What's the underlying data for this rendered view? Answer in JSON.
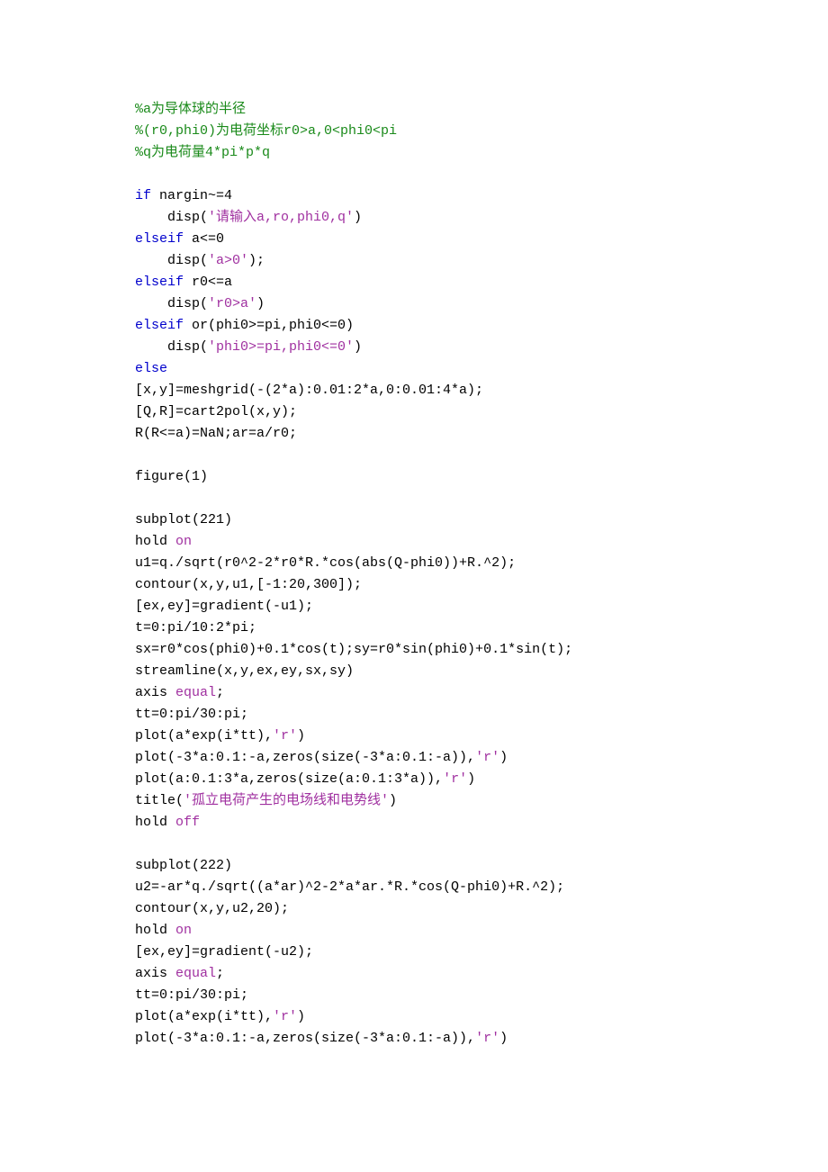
{
  "code": {
    "lines": [
      [
        {
          "cls": "comment",
          "t": "%a为导体球的半径"
        }
      ],
      [
        {
          "cls": "comment",
          "t": "%(r0,phi0)为电荷坐标r0>a,0<phi0<pi"
        }
      ],
      [
        {
          "cls": "comment",
          "t": "%q为电荷量4*pi*p*q"
        }
      ],
      [
        {
          "cls": "plain",
          "t": ""
        }
      ],
      [
        {
          "cls": "keyword",
          "t": "if"
        },
        {
          "cls": "plain",
          "t": " nargin~=4"
        }
      ],
      [
        {
          "cls": "plain",
          "t": "    disp("
        },
        {
          "cls": "string",
          "t": "'请输入a,ro,phi0,q'"
        },
        {
          "cls": "plain",
          "t": ")"
        }
      ],
      [
        {
          "cls": "keyword",
          "t": "elseif"
        },
        {
          "cls": "plain",
          "t": " a<=0"
        }
      ],
      [
        {
          "cls": "plain",
          "t": "    disp("
        },
        {
          "cls": "string",
          "t": "'a>0'"
        },
        {
          "cls": "plain",
          "t": ");"
        }
      ],
      [
        {
          "cls": "keyword",
          "t": "elseif"
        },
        {
          "cls": "plain",
          "t": " r0<=a"
        }
      ],
      [
        {
          "cls": "plain",
          "t": "    disp("
        },
        {
          "cls": "string",
          "t": "'r0>a'"
        },
        {
          "cls": "plain",
          "t": ")"
        }
      ],
      [
        {
          "cls": "keyword",
          "t": "elseif"
        },
        {
          "cls": "plain",
          "t": " or(phi0>=pi,phi0<=0)"
        }
      ],
      [
        {
          "cls": "plain",
          "t": "    disp("
        },
        {
          "cls": "string",
          "t": "'phi0>=pi,phi0<=0'"
        },
        {
          "cls": "plain",
          "t": ")"
        }
      ],
      [
        {
          "cls": "keyword",
          "t": "else"
        }
      ],
      [
        {
          "cls": "plain",
          "t": "[x,y]=meshgrid(-(2*a):0.01:2*a,0:0.01:4*a);"
        }
      ],
      [
        {
          "cls": "plain",
          "t": "[Q,R]=cart2pol(x,y);"
        }
      ],
      [
        {
          "cls": "plain",
          "t": "R(R<=a)=NaN;ar=a/r0;"
        }
      ],
      [
        {
          "cls": "plain",
          "t": ""
        }
      ],
      [
        {
          "cls": "plain",
          "t": "figure(1)"
        }
      ],
      [
        {
          "cls": "plain",
          "t": ""
        }
      ],
      [
        {
          "cls": "plain",
          "t": "subplot(221)"
        }
      ],
      [
        {
          "cls": "plain",
          "t": "hold "
        },
        {
          "cls": "string",
          "t": "on"
        }
      ],
      [
        {
          "cls": "plain",
          "t": "u1=q./sqrt(r0^2-2*r0*R.*cos(abs(Q-phi0))+R.^2);"
        }
      ],
      [
        {
          "cls": "plain",
          "t": "contour(x,y,u1,[-1:20,300]);"
        }
      ],
      [
        {
          "cls": "plain",
          "t": "[ex,ey]=gradient(-u1);"
        }
      ],
      [
        {
          "cls": "plain",
          "t": "t=0:pi/10:2*pi;"
        }
      ],
      [
        {
          "cls": "plain",
          "t": "sx=r0*cos(phi0)+0.1*cos(t);sy=r0*sin(phi0)+0.1*sin(t);"
        }
      ],
      [
        {
          "cls": "plain",
          "t": "streamline(x,y,ex,ey,sx,sy)"
        }
      ],
      [
        {
          "cls": "plain",
          "t": "axis "
        },
        {
          "cls": "string",
          "t": "equal"
        },
        {
          "cls": "plain",
          "t": ";"
        }
      ],
      [
        {
          "cls": "plain",
          "t": "tt=0:pi/30:pi;"
        }
      ],
      [
        {
          "cls": "plain",
          "t": "plot(a*exp(i*tt),"
        },
        {
          "cls": "string",
          "t": "'r'"
        },
        {
          "cls": "plain",
          "t": ")"
        }
      ],
      [
        {
          "cls": "plain",
          "t": "plot(-3*a:0.1:-a,zeros(size(-3*a:0.1:-a)),"
        },
        {
          "cls": "string",
          "t": "'r'"
        },
        {
          "cls": "plain",
          "t": ")"
        }
      ],
      [
        {
          "cls": "plain",
          "t": "plot(a:0.1:3*a,zeros(size(a:0.1:3*a)),"
        },
        {
          "cls": "string",
          "t": "'r'"
        },
        {
          "cls": "plain",
          "t": ")"
        }
      ],
      [
        {
          "cls": "plain",
          "t": "title("
        },
        {
          "cls": "string",
          "t": "'孤立电荷产生的电场线和电势线'"
        },
        {
          "cls": "plain",
          "t": ")"
        }
      ],
      [
        {
          "cls": "plain",
          "t": "hold "
        },
        {
          "cls": "string",
          "t": "off"
        }
      ],
      [
        {
          "cls": "plain",
          "t": ""
        }
      ],
      [
        {
          "cls": "plain",
          "t": "subplot(222)"
        }
      ],
      [
        {
          "cls": "plain",
          "t": "u2=-ar*q./sqrt((a*ar)^2-2*a*ar.*R.*cos(Q-phi0)+R.^2);"
        }
      ],
      [
        {
          "cls": "plain",
          "t": "contour(x,y,u2,20);"
        }
      ],
      [
        {
          "cls": "plain",
          "t": "hold "
        },
        {
          "cls": "string",
          "t": "on"
        }
      ],
      [
        {
          "cls": "plain",
          "t": "[ex,ey]=gradient(-u2);"
        }
      ],
      [
        {
          "cls": "plain",
          "t": "axis "
        },
        {
          "cls": "string",
          "t": "equal"
        },
        {
          "cls": "plain",
          "t": ";"
        }
      ],
      [
        {
          "cls": "plain",
          "t": "tt=0:pi/30:pi;"
        }
      ],
      [
        {
          "cls": "plain",
          "t": "plot(a*exp(i*tt),"
        },
        {
          "cls": "string",
          "t": "'r'"
        },
        {
          "cls": "plain",
          "t": ")"
        }
      ],
      [
        {
          "cls": "plain",
          "t": "plot(-3*a:0.1:-a,zeros(size(-3*a:0.1:-a)),"
        },
        {
          "cls": "string",
          "t": "'r'"
        },
        {
          "cls": "plain",
          "t": ")"
        }
      ]
    ]
  }
}
